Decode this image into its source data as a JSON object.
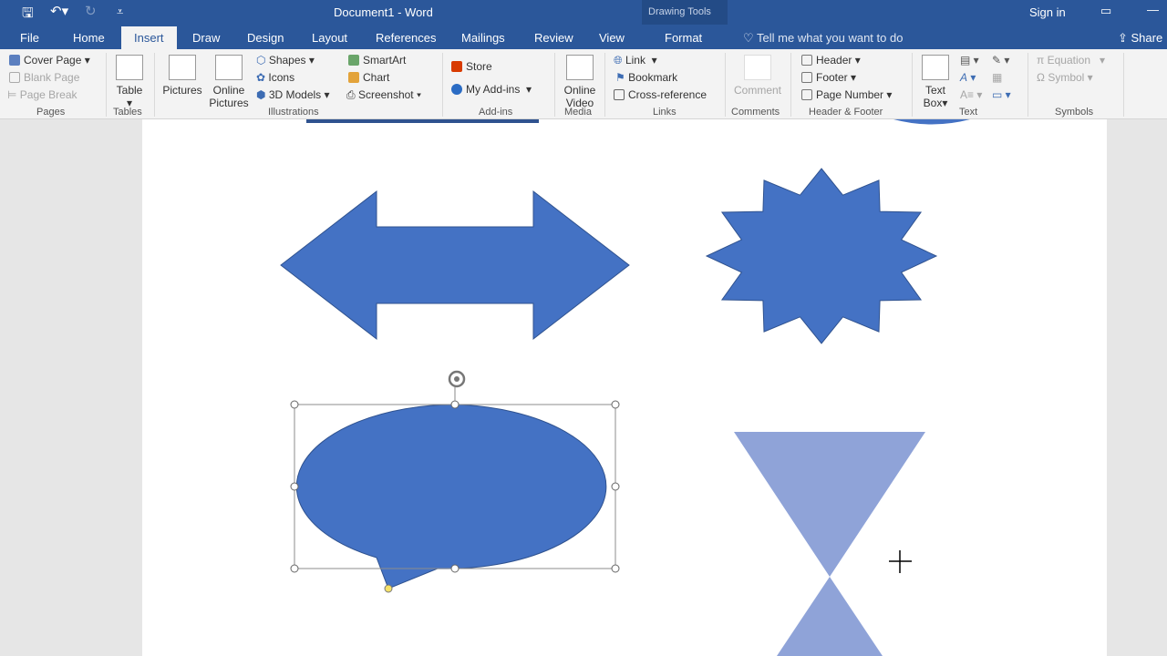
{
  "titlebar": {
    "title": "Document1  -  Word",
    "context": "Drawing Tools",
    "signin": "Sign in",
    "qat": [
      "save-icon",
      "undo-icon",
      "redo-icon",
      "customize-icon"
    ]
  },
  "tabs": {
    "file": "File",
    "home": "Home",
    "insert": "Insert",
    "draw": "Draw",
    "design": "Design",
    "layout": "Layout",
    "references": "References",
    "mailings": "Mailings",
    "review": "Review",
    "view": "View",
    "format": "Format",
    "tellme": "Tell me what you want to do",
    "share": "Share"
  },
  "ribbon": {
    "pages": {
      "label": "Pages",
      "cover": "Cover Page",
      "blank": "Blank Page",
      "break": "Page Break"
    },
    "tables": {
      "label": "Tables",
      "table": "Table"
    },
    "illustrations": {
      "label": "Illustrations",
      "pictures": "Pictures",
      "online1": "Online",
      "online2": "Pictures",
      "shapes": "Shapes",
      "icons": "Icons",
      "models": "3D Models",
      "smartart": "SmartArt",
      "chart": "Chart",
      "screenshot": "Screenshot"
    },
    "addins": {
      "label": "Add-ins",
      "store": "Store",
      "myaddins": "My Add-ins"
    },
    "media": {
      "label": "Media",
      "v1": "Online",
      "v2": "Video"
    },
    "links": {
      "label": "Links",
      "link": "Link",
      "bookmark": "Bookmark",
      "crossref": "Cross-reference"
    },
    "comments": {
      "label": "Comments",
      "comment": "Comment"
    },
    "hf": {
      "label": "Header & Footer",
      "header": "Header",
      "footer": "Footer",
      "pagenum": "Page Number"
    },
    "text": {
      "label": "Text",
      "tb1": "Text",
      "tb2": "Box"
    },
    "symbols": {
      "label": "Symbols",
      "equation": "Equation",
      "symbol": "Symbol"
    }
  },
  "colors": {
    "accent": "#2b579a",
    "shape_fill": "#4472c4",
    "shape_stroke": "#2f528f",
    "hourglass_fill": "#8fa3d8"
  }
}
